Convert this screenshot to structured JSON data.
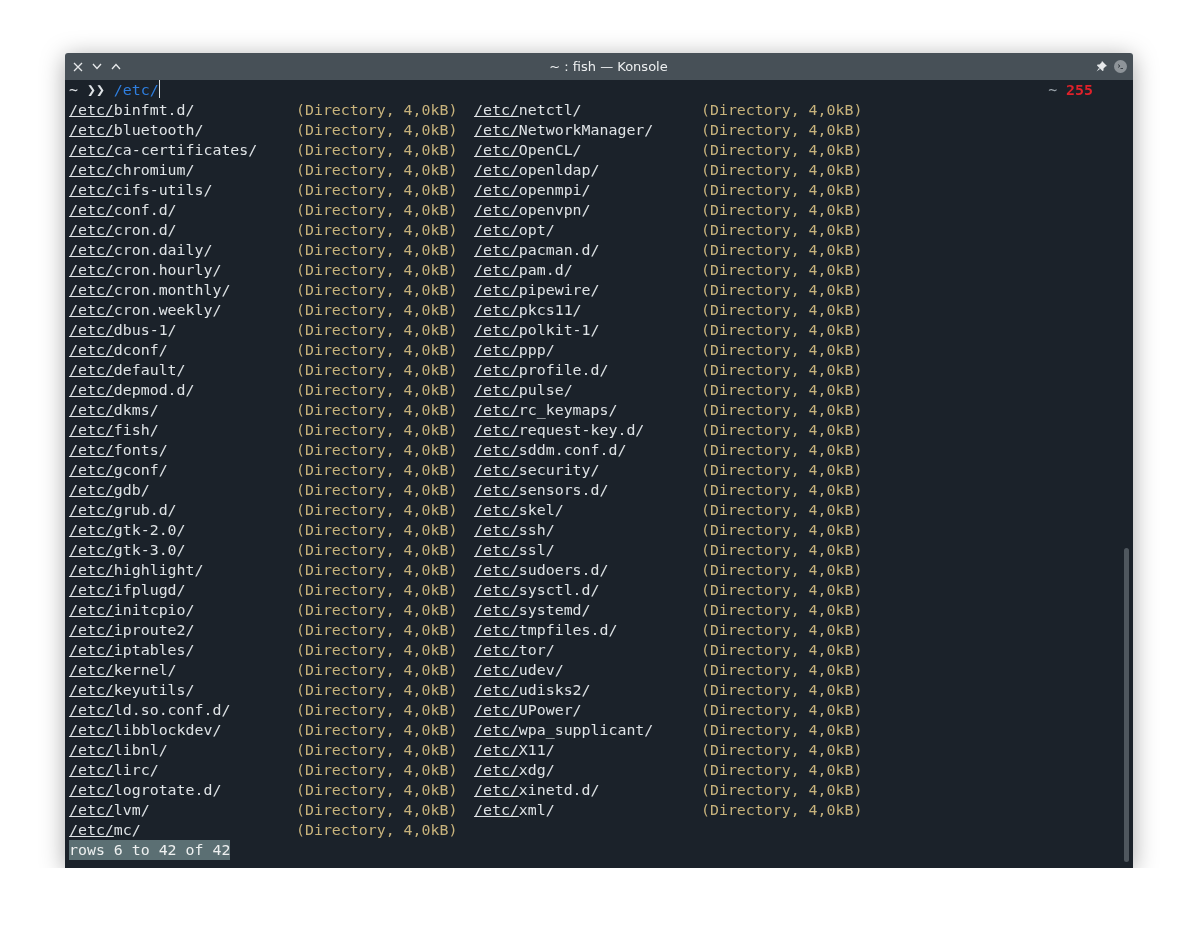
{
  "window": {
    "title": "~ : fish — Konsole"
  },
  "prompt": {
    "cwd": "~",
    "symbol": "❯❯",
    "input": "/etc/",
    "right_cwd": "~",
    "status": "255"
  },
  "completion_columns": [
    [
      {
        "prefix": "/etc/",
        "name": "binfmt.d/",
        "info": "(Directory, 4,0kB)"
      },
      {
        "prefix": "/etc/",
        "name": "bluetooth/",
        "info": "(Directory, 4,0kB)"
      },
      {
        "prefix": "/etc/",
        "name": "ca-certificates/",
        "info": "(Directory, 4,0kB)"
      },
      {
        "prefix": "/etc/",
        "name": "chromium/",
        "info": "(Directory, 4,0kB)"
      },
      {
        "prefix": "/etc/",
        "name": "cifs-utils/",
        "info": "(Directory, 4,0kB)"
      },
      {
        "prefix": "/etc/",
        "name": "conf.d/",
        "info": "(Directory, 4,0kB)"
      },
      {
        "prefix": "/etc/",
        "name": "cron.d/",
        "info": "(Directory, 4,0kB)"
      },
      {
        "prefix": "/etc/",
        "name": "cron.daily/",
        "info": "(Directory, 4,0kB)"
      },
      {
        "prefix": "/etc/",
        "name": "cron.hourly/",
        "info": "(Directory, 4,0kB)"
      },
      {
        "prefix": "/etc/",
        "name": "cron.monthly/",
        "info": "(Directory, 4,0kB)"
      },
      {
        "prefix": "/etc/",
        "name": "cron.weekly/",
        "info": "(Directory, 4,0kB)"
      },
      {
        "prefix": "/etc/",
        "name": "dbus-1/",
        "info": "(Directory, 4,0kB)"
      },
      {
        "prefix": "/etc/",
        "name": "dconf/",
        "info": "(Directory, 4,0kB)"
      },
      {
        "prefix": "/etc/",
        "name": "default/",
        "info": "(Directory, 4,0kB)"
      },
      {
        "prefix": "/etc/",
        "name": "depmod.d/",
        "info": "(Directory, 4,0kB)"
      },
      {
        "prefix": "/etc/",
        "name": "dkms/",
        "info": "(Directory, 4,0kB)"
      },
      {
        "prefix": "/etc/",
        "name": "fish/",
        "info": "(Directory, 4,0kB)"
      },
      {
        "prefix": "/etc/",
        "name": "fonts/",
        "info": "(Directory, 4,0kB)"
      },
      {
        "prefix": "/etc/",
        "name": "gconf/",
        "info": "(Directory, 4,0kB)"
      },
      {
        "prefix": "/etc/",
        "name": "gdb/",
        "info": "(Directory, 4,0kB)"
      },
      {
        "prefix": "/etc/",
        "name": "grub.d/",
        "info": "(Directory, 4,0kB)"
      },
      {
        "prefix": "/etc/",
        "name": "gtk-2.0/",
        "info": "(Directory, 4,0kB)"
      },
      {
        "prefix": "/etc/",
        "name": "gtk-3.0/",
        "info": "(Directory, 4,0kB)"
      },
      {
        "prefix": "/etc/",
        "name": "highlight/",
        "info": "(Directory, 4,0kB)"
      },
      {
        "prefix": "/etc/",
        "name": "ifplugd/",
        "info": "(Directory, 4,0kB)"
      },
      {
        "prefix": "/etc/",
        "name": "initcpio/",
        "info": "(Directory, 4,0kB)"
      },
      {
        "prefix": "/etc/",
        "name": "iproute2/",
        "info": "(Directory, 4,0kB)"
      },
      {
        "prefix": "/etc/",
        "name": "iptables/",
        "info": "(Directory, 4,0kB)"
      },
      {
        "prefix": "/etc/",
        "name": "kernel/",
        "info": "(Directory, 4,0kB)"
      },
      {
        "prefix": "/etc/",
        "name": "keyutils/",
        "info": "(Directory, 4,0kB)"
      },
      {
        "prefix": "/etc/",
        "name": "ld.so.conf.d/",
        "info": "(Directory, 4,0kB)"
      },
      {
        "prefix": "/etc/",
        "name": "libblockdev/",
        "info": "(Directory, 4,0kB)"
      },
      {
        "prefix": "/etc/",
        "name": "libnl/",
        "info": "(Directory, 4,0kB)"
      },
      {
        "prefix": "/etc/",
        "name": "lirc/",
        "info": "(Directory, 4,0kB)"
      },
      {
        "prefix": "/etc/",
        "name": "logrotate.d/",
        "info": "(Directory, 4,0kB)"
      },
      {
        "prefix": "/etc/",
        "name": "lvm/",
        "info": "(Directory, 4,0kB)"
      },
      {
        "prefix": "/etc/",
        "name": "mc/",
        "info": "(Directory, 4,0kB)"
      }
    ],
    [
      {
        "prefix": "/etc/",
        "name": "netctl/",
        "info": "(Directory, 4,0kB)"
      },
      {
        "prefix": "/etc/",
        "name": "NetworkManager/",
        "info": "(Directory, 4,0kB)"
      },
      {
        "prefix": "/etc/",
        "name": "OpenCL/",
        "info": "(Directory, 4,0kB)"
      },
      {
        "prefix": "/etc/",
        "name": "openldap/",
        "info": "(Directory, 4,0kB)"
      },
      {
        "prefix": "/etc/",
        "name": "openmpi/",
        "info": "(Directory, 4,0kB)"
      },
      {
        "prefix": "/etc/",
        "name": "openvpn/",
        "info": "(Directory, 4,0kB)"
      },
      {
        "prefix": "/etc/",
        "name": "opt/",
        "info": "(Directory, 4,0kB)"
      },
      {
        "prefix": "/etc/",
        "name": "pacman.d/",
        "info": "(Directory, 4,0kB)"
      },
      {
        "prefix": "/etc/",
        "name": "pam.d/",
        "info": "(Directory, 4,0kB)"
      },
      {
        "prefix": "/etc/",
        "name": "pipewire/",
        "info": "(Directory, 4,0kB)"
      },
      {
        "prefix": "/etc/",
        "name": "pkcs11/",
        "info": "(Directory, 4,0kB)"
      },
      {
        "prefix": "/etc/",
        "name": "polkit-1/",
        "info": "(Directory, 4,0kB)"
      },
      {
        "prefix": "/etc/",
        "name": "ppp/",
        "info": "(Directory, 4,0kB)"
      },
      {
        "prefix": "/etc/",
        "name": "profile.d/",
        "info": "(Directory, 4,0kB)"
      },
      {
        "prefix": "/etc/",
        "name": "pulse/",
        "info": "(Directory, 4,0kB)"
      },
      {
        "prefix": "/etc/",
        "name": "rc_keymaps/",
        "info": "(Directory, 4,0kB)"
      },
      {
        "prefix": "/etc/",
        "name": "request-key.d/",
        "info": "(Directory, 4,0kB)"
      },
      {
        "prefix": "/etc/",
        "name": "sddm.conf.d/",
        "info": "(Directory, 4,0kB)"
      },
      {
        "prefix": "/etc/",
        "name": "security/",
        "info": "(Directory, 4,0kB)"
      },
      {
        "prefix": "/etc/",
        "name": "sensors.d/",
        "info": "(Directory, 4,0kB)"
      },
      {
        "prefix": "/etc/",
        "name": "skel/",
        "info": "(Directory, 4,0kB)"
      },
      {
        "prefix": "/etc/",
        "name": "ssh/",
        "info": "(Directory, 4,0kB)"
      },
      {
        "prefix": "/etc/",
        "name": "ssl/",
        "info": "(Directory, 4,0kB)"
      },
      {
        "prefix": "/etc/",
        "name": "sudoers.d/",
        "info": "(Directory, 4,0kB)"
      },
      {
        "prefix": "/etc/",
        "name": "sysctl.d/",
        "info": "(Directory, 4,0kB)"
      },
      {
        "prefix": "/etc/",
        "name": "systemd/",
        "info": "(Directory, 4,0kB)"
      },
      {
        "prefix": "/etc/",
        "name": "tmpfiles.d/",
        "info": "(Directory, 4,0kB)"
      },
      {
        "prefix": "/etc/",
        "name": "tor/",
        "info": "(Directory, 4,0kB)"
      },
      {
        "prefix": "/etc/",
        "name": "udev/",
        "info": "(Directory, 4,0kB)"
      },
      {
        "prefix": "/etc/",
        "name": "udisks2/",
        "info": "(Directory, 4,0kB)"
      },
      {
        "prefix": "/etc/",
        "name": "UPower/",
        "info": "(Directory, 4,0kB)"
      },
      {
        "prefix": "/etc/",
        "name": "wpa_supplicant/",
        "info": "(Directory, 4,0kB)"
      },
      {
        "prefix": "/etc/",
        "name": "X11/",
        "info": "(Directory, 4,0kB)"
      },
      {
        "prefix": "/etc/",
        "name": "xdg/",
        "info": "(Directory, 4,0kB)"
      },
      {
        "prefix": "/etc/",
        "name": "xinetd.d/",
        "info": "(Directory, 4,0kB)"
      },
      {
        "prefix": "/etc/",
        "name": "xml/",
        "info": "(Directory, 4,0kB)"
      }
    ]
  ],
  "pager_status": "rows 6 to 42 of 42"
}
